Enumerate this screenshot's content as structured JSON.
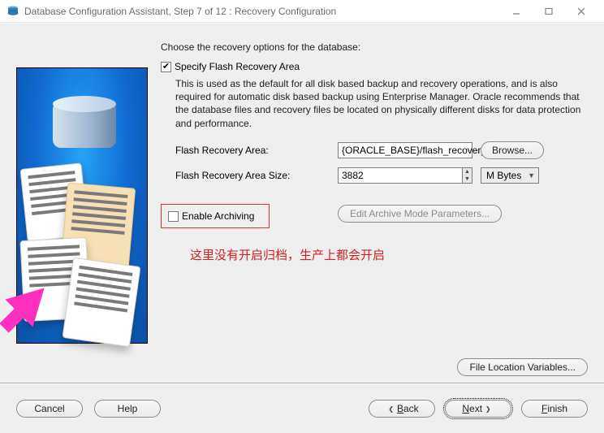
{
  "window": {
    "title": "Database Configuration Assistant, Step 7 of 12 : Recovery Configuration"
  },
  "instruction": "Choose the recovery options for the database:",
  "flash": {
    "checkbox_label": "Specify Flash Recovery Area",
    "checked_glyph": "✔",
    "description": "This is used as the default for all disk based backup and recovery operations, and is also required for automatic disk based backup using Enterprise Manager. Oracle recommends that the database files and recovery files be located on physically different disks for data protection and performance.",
    "area_label": "Flash Recovery Area:",
    "area_value": "{ORACLE_BASE}/flash_recovery_",
    "browse_label": "Browse...",
    "size_label": "Flash Recovery Area Size:",
    "size_value": "3882",
    "size_unit": "M Bytes"
  },
  "archive": {
    "checkbox_label": "Enable Archiving",
    "edit_button": "Edit Archive Mode Parameters..."
  },
  "annotation": "这里没有开启归档，生产上都会开启",
  "file_location_button": "File Location Variables...",
  "buttons": {
    "cancel": "Cancel",
    "help": "Help",
    "back": "Back",
    "next": "Next",
    "finish": "Finish"
  }
}
